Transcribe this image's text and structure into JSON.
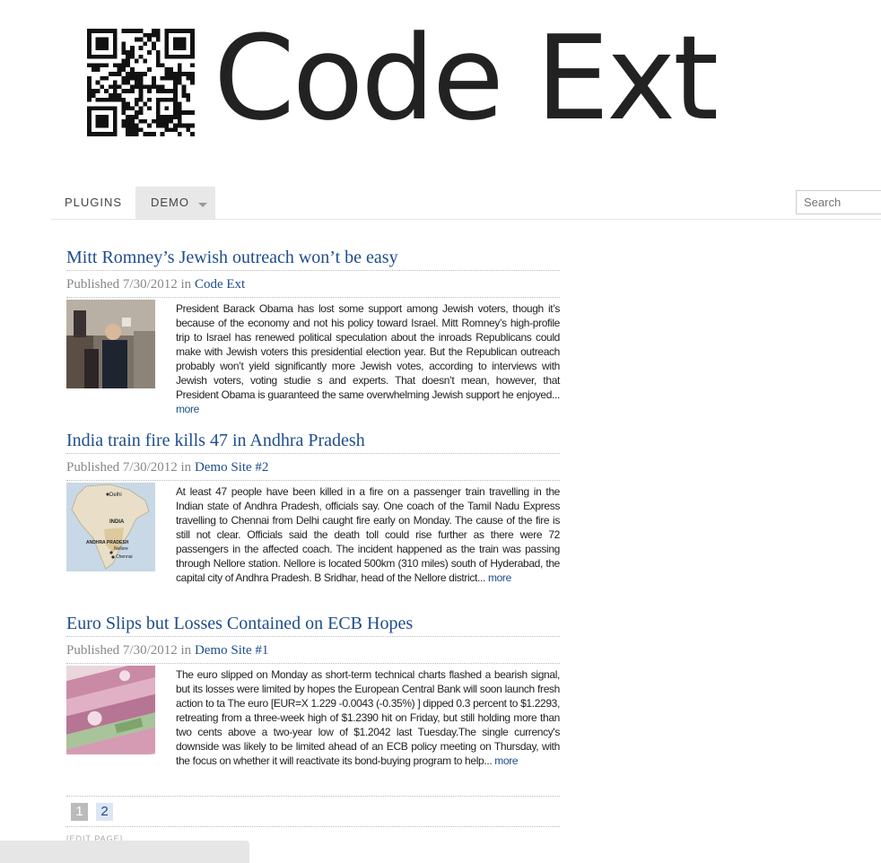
{
  "site": {
    "title": "Code Ext"
  },
  "nav": {
    "items": [
      {
        "label": "PLUGINS"
      },
      {
        "label": "DEMO"
      }
    ],
    "search_placeholder": "Search"
  },
  "posts": [
    {
      "title": "Mitt Romney’s Jewish outreach won’t be easy",
      "published_label": "Published 7/30/2012 in",
      "category": "Code Ext",
      "excerpt": "President Barack Obama has lost some support among Jewish voters, though it’s because of the economy and not his policy toward Israel. Mitt Romney’s high-profile trip to Israel has renewed political speculation about the inroads Republicans could make with Jewish voters this presidential election year. But the Republican outreach probably won’t yield significantly more Jewish votes, according to interviews with Jewish voters, voting studie s and experts. That doesn’t mean, however, that President Obama is guaranteed the same overwhelming Jewish support he enjoyed...",
      "more": "more"
    },
    {
      "title": "India train fire kills 47 in Andhra Pradesh",
      "published_label": "Published 7/30/2012 in",
      "category": "Demo Site #2",
      "excerpt": "At least 47 people have been killed in a fire on a passenger train travelling in the Indian state of Andhra Pradesh, officials say. One coach of the Tamil Nadu Express travelling to Chennai from Delhi caught fire early on Monday. The cause of the fire is still not clear. Officials said the death toll could rise further as there were 72 passengers in the affected coach. The incident happened as the train was passing through Nellore station. Nellore is located 500km (310 miles) south of Hyderabad, the capital city of Andhra Pradesh. B Sridhar, head of the Nellore district...",
      "more": "more",
      "map_labels": {
        "delhi": "Delhi",
        "india": "INDIA",
        "andhra": "ANDHRA PRADESH",
        "nellore": "Nellore",
        "chennai": "Chennai"
      }
    },
    {
      "title": "Euro Slips but Losses Contained on ECB Hopes",
      "published_label": "Published 7/30/2012 in",
      "category": "Demo Site #1",
      "excerpt": "The euro slipped on Monday as short-term technical charts flashed a bearish signal, but its losses were limited by hopes the European Central Bank will soon launch fresh action to ta The euro [EUR=X  1.229   -0.0043  (-0.35%)   ] dipped 0.3 percent to $1.2293, retreating from a three-week high of $1.2390 hit on Friday, but still holding more than two cents above a two-year low of $1.2042  last Tuesday.The single currency's downside was likely to be limited ahead of an ECB policy meeting on Thursday, with the focus on whether it will reactivate its bond-buying program to help...",
      "more": "more"
    }
  ],
  "pagination": {
    "pages": [
      "1",
      "2"
    ],
    "current": "1"
  },
  "footer": {
    "edit_page": "[EDIT PAGE]"
  }
}
